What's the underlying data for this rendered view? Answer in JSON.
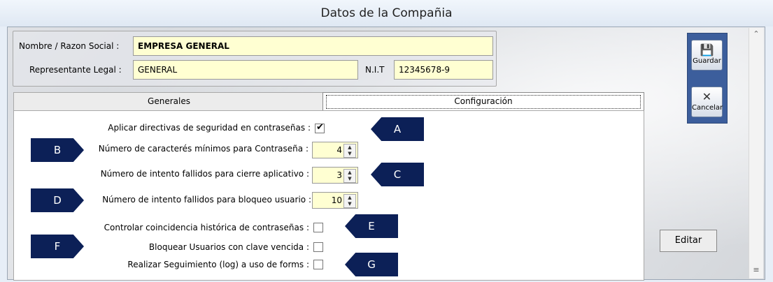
{
  "window": {
    "title": "Datos de la Compañia"
  },
  "company": {
    "razon_label": "Nombre / Razon Social :",
    "razon_value": "EMPRESA GENERAL",
    "rep_label": "Representante Legal :",
    "rep_value": "GENERAL",
    "nit_label": "N.I.T",
    "nit_value": "12345678-9"
  },
  "toolbar": {
    "guardar": "Guardar",
    "cancelar": "Cancelar",
    "guardar_icon": "floppy-disk-icon",
    "cancelar_icon": "x-icon"
  },
  "tabs": [
    {
      "label": "Generales",
      "active": false
    },
    {
      "label": "Configuración",
      "active": true
    }
  ],
  "settings": {
    "row1": {
      "label": "Aplicar directivas de seguridad en contraseñas :",
      "checked": true
    },
    "row2": {
      "label": "Número de caracterés mínimos para Contraseña :",
      "value": "4"
    },
    "row3": {
      "label": "Número de intento fallidos para cierre aplicativo :",
      "value": "3"
    },
    "row4": {
      "label": "Número de intento fallidos para bloqueo usuario :",
      "value": "10"
    },
    "row5": {
      "label": "Controlar coincidencia histórica de contraseñas :",
      "checked": false
    },
    "row6": {
      "label": "Bloquear Usuarios con clave vencida :",
      "checked": false
    },
    "row7": {
      "label": "Realizar Seguimiento (log) a uso de forms :",
      "checked": false
    }
  },
  "callouts": {
    "a": "A",
    "b": "B",
    "c": "C",
    "d": "D",
    "e": "E",
    "f": "F",
    "g": "G"
  },
  "actions": {
    "editar": "Editar"
  },
  "colors": {
    "callout": "#0c2057",
    "field_bg": "#ffffd2",
    "toolbar_bg": "#3c5e9c"
  }
}
